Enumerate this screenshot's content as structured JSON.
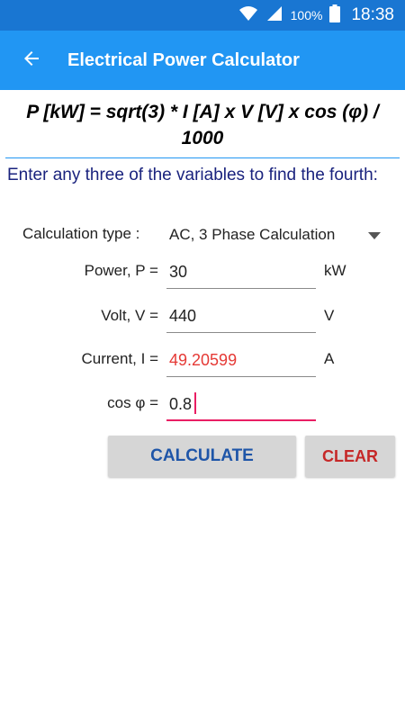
{
  "status": {
    "battery_text": "100%",
    "time": "18:38"
  },
  "header": {
    "title": "Electrical Power Calculator",
    "back_icon": "arrow-left-icon"
  },
  "formula": {
    "line1": "P [kW] = sqrt(3) * I [A] x V [V] x cos (φ) /",
    "line2": "1000"
  },
  "instruction": "Enter any three of the variables to find the fourth:",
  "calc_type": {
    "label": "Calculation type :",
    "value": "AC, 3 Phase Calculation"
  },
  "fields": {
    "power": {
      "label": "Power, P =",
      "value": "30",
      "unit": "kW"
    },
    "volt": {
      "label": "Volt, V =",
      "value": "440",
      "unit": "V"
    },
    "current": {
      "label": "Current, I =",
      "value": "49.20599",
      "unit": "A"
    },
    "cos": {
      "label": "cos φ =",
      "value": "0.8"
    }
  },
  "buttons": {
    "calculate": "CALCULATE",
    "clear": "CLEAR"
  },
  "colors": {
    "app_bar": "#2196f3",
    "status_bar": "#1976d2",
    "result": "#e53935",
    "focus": "#e91e63"
  }
}
